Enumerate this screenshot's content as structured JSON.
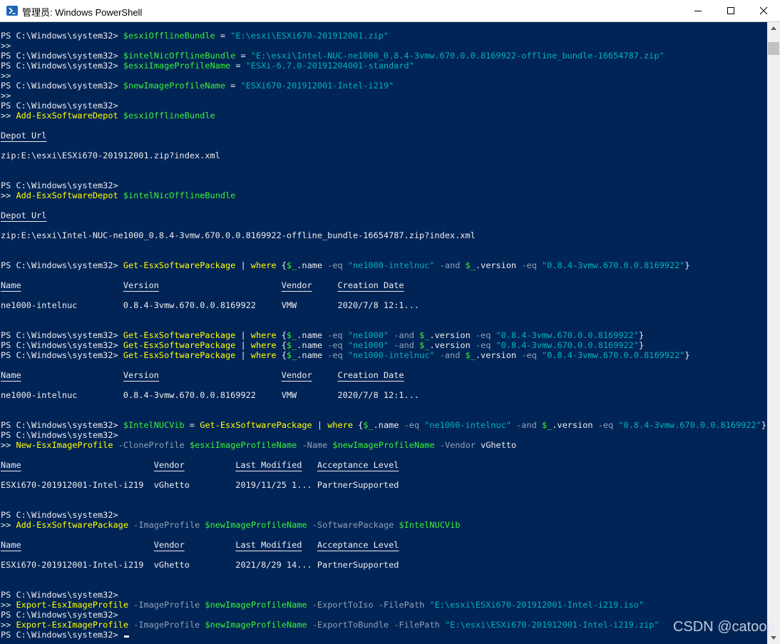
{
  "window": {
    "title": "管理员: Windows PowerShell",
    "icon": "powershell-icon",
    "controls": [
      "minimize-icon",
      "maximize-icon",
      "close-icon"
    ]
  },
  "colors": {
    "background": "#012456",
    "foreground": "#eeedf0",
    "variable": "#3bf13b",
    "command": "#ffff00",
    "string": "#00b5b5",
    "operator": "#8fa0b8"
  },
  "watermark": "CSDN @catoop",
  "console_lines": [
    {
      "segs": [
        {
          "t": "PS C:\\Windows\\system32> "
        },
        {
          "t": "$esxiOfflineBundle",
          "c": "var"
        },
        {
          "t": " = "
        },
        {
          "t": "\"E:\\esxi\\ESXi670-201912001.zip\"",
          "c": "str"
        }
      ]
    },
    {
      "segs": [
        {
          "t": ">>"
        }
      ]
    },
    {
      "segs": [
        {
          "t": "PS C:\\Windows\\system32> "
        },
        {
          "t": "$intelNicOfflineBundle",
          "c": "var"
        },
        {
          "t": " = "
        },
        {
          "t": "\"E:\\esxi\\Intel-NUC-ne1000_0.8.4-3vmw.670.0.0.8169922-offline_bundle-16654787.zip\"",
          "c": "str"
        }
      ]
    },
    {
      "segs": [
        {
          "t": "PS C:\\Windows\\system32> "
        },
        {
          "t": "$esxiImageProfileName",
          "c": "var"
        },
        {
          "t": " = "
        },
        {
          "t": "\"ESXi-6.7.0-20191204001-standard\"",
          "c": "str"
        }
      ]
    },
    {
      "segs": [
        {
          "t": ">>"
        }
      ]
    },
    {
      "segs": [
        {
          "t": "PS C:\\Windows\\system32> "
        },
        {
          "t": "$newImageProfileName",
          "c": "var"
        },
        {
          "t": " = "
        },
        {
          "t": "\"ESXi670-201912001-Intel-i219\"",
          "c": "str"
        }
      ]
    },
    {
      "segs": [
        {
          "t": ">>"
        }
      ]
    },
    {
      "segs": [
        {
          "t": "PS C:\\Windows\\system32>"
        }
      ]
    },
    {
      "segs": [
        {
          "t": ">> "
        },
        {
          "t": "Add-EsxSoftwareDepot",
          "c": "cmd"
        },
        {
          "t": " "
        },
        {
          "t": "$esxiOfflineBundle",
          "c": "var"
        }
      ]
    },
    {
      "segs": []
    },
    {
      "segs": [
        {
          "t": "Depot Url",
          "c": "hdr"
        }
      ]
    },
    {
      "segs": []
    },
    {
      "segs": [
        {
          "t": "zip:E:\\esxi\\ESXi670-201912001.zip?index.xml"
        }
      ]
    },
    {
      "segs": []
    },
    {
      "segs": []
    },
    {
      "segs": [
        {
          "t": "PS C:\\Windows\\system32>"
        }
      ]
    },
    {
      "segs": [
        {
          "t": ">> "
        },
        {
          "t": "Add-EsxSoftwareDepot",
          "c": "cmd"
        },
        {
          "t": " "
        },
        {
          "t": "$intelNicOfflineBundle",
          "c": "var"
        }
      ]
    },
    {
      "segs": []
    },
    {
      "segs": [
        {
          "t": "Depot Url",
          "c": "hdr"
        }
      ]
    },
    {
      "segs": []
    },
    {
      "segs": [
        {
          "t": "zip:E:\\esxi\\Intel-NUC-ne1000_0.8.4-3vmw.670.0.0.8169922-offline_bundle-16654787.zip?index.xml"
        }
      ]
    },
    {
      "segs": []
    },
    {
      "segs": []
    },
    {
      "segs": [
        {
          "t": "PS C:\\Windows\\system32> "
        },
        {
          "t": "Get-EsxSoftwarePackage",
          "c": "cmd"
        },
        {
          "t": " | "
        },
        {
          "t": "where",
          "c": "cmd"
        },
        {
          "t": " {"
        },
        {
          "t": "$_",
          "c": "var"
        },
        {
          "t": ".name "
        },
        {
          "t": "-eq",
          "c": "op"
        },
        {
          "t": " "
        },
        {
          "t": "\"ne1000-intelnuc\"",
          "c": "str"
        },
        {
          "t": " "
        },
        {
          "t": "-and",
          "c": "op"
        },
        {
          "t": " "
        },
        {
          "t": "$_",
          "c": "var"
        },
        {
          "t": ".version "
        },
        {
          "t": "-eq",
          "c": "op"
        },
        {
          "t": " "
        },
        {
          "t": "\"0.8.4-3vmw.670.0.0.8169922\"",
          "c": "str"
        },
        {
          "t": "}"
        }
      ]
    },
    {
      "segs": []
    },
    {
      "segs": [
        {
          "t": "Name",
          "c": "hdr"
        },
        {
          "t": "                    "
        },
        {
          "t": "Version",
          "c": "hdr"
        },
        {
          "t": "                        "
        },
        {
          "t": "Vendor",
          "c": "hdr"
        },
        {
          "t": "     "
        },
        {
          "t": "Creation Date",
          "c": "hdr"
        }
      ]
    },
    {
      "segs": []
    },
    {
      "segs": [
        {
          "t": "ne1000-intelnuc         0.8.4-3vmw.670.0.0.8169922     VMW        2020/7/8 12:1..."
        }
      ]
    },
    {
      "segs": []
    },
    {
      "segs": []
    },
    {
      "segs": [
        {
          "t": "PS C:\\Windows\\system32> "
        },
        {
          "t": "Get-EsxSoftwarePackage",
          "c": "cmd"
        },
        {
          "t": " | "
        },
        {
          "t": "where",
          "c": "cmd"
        },
        {
          "t": " {"
        },
        {
          "t": "$_",
          "c": "var"
        },
        {
          "t": ".name "
        },
        {
          "t": "-eq",
          "c": "op"
        },
        {
          "t": " "
        },
        {
          "t": "\"ne1000\"",
          "c": "str"
        },
        {
          "t": " "
        },
        {
          "t": "-and",
          "c": "op"
        },
        {
          "t": " "
        },
        {
          "t": "$_",
          "c": "var"
        },
        {
          "t": ".version "
        },
        {
          "t": "-eq",
          "c": "op"
        },
        {
          "t": " "
        },
        {
          "t": "\"0.8.4-3vmw.670.0.0.8169922\"",
          "c": "str"
        },
        {
          "t": "}"
        }
      ]
    },
    {
      "segs": [
        {
          "t": "PS C:\\Windows\\system32> "
        },
        {
          "t": "Get-EsxSoftwarePackage",
          "c": "cmd"
        },
        {
          "t": " | "
        },
        {
          "t": "where",
          "c": "cmd"
        },
        {
          "t": " {"
        },
        {
          "t": "$_",
          "c": "var"
        },
        {
          "t": ".name "
        },
        {
          "t": "-eq",
          "c": "op"
        },
        {
          "t": " "
        },
        {
          "t": "\"ne1000\"",
          "c": "str"
        },
        {
          "t": " "
        },
        {
          "t": "-and",
          "c": "op"
        },
        {
          "t": " "
        },
        {
          "t": "$_",
          "c": "var"
        },
        {
          "t": ".version "
        },
        {
          "t": "-eq",
          "c": "op"
        },
        {
          "t": " "
        },
        {
          "t": "\"0.8.4-3vmw.670.0.0.8169922\"",
          "c": "str"
        },
        {
          "t": "}"
        }
      ]
    },
    {
      "segs": [
        {
          "t": "PS C:\\Windows\\system32> "
        },
        {
          "t": "Get-EsxSoftwarePackage",
          "c": "cmd"
        },
        {
          "t": " | "
        },
        {
          "t": "where",
          "c": "cmd"
        },
        {
          "t": " {"
        },
        {
          "t": "$_",
          "c": "var"
        },
        {
          "t": ".name "
        },
        {
          "t": "-eq",
          "c": "op"
        },
        {
          "t": " "
        },
        {
          "t": "\"ne1000-intelnuc\"",
          "c": "str"
        },
        {
          "t": " "
        },
        {
          "t": "-and",
          "c": "op"
        },
        {
          "t": " "
        },
        {
          "t": "$_",
          "c": "var"
        },
        {
          "t": ".version "
        },
        {
          "t": "-eq",
          "c": "op"
        },
        {
          "t": " "
        },
        {
          "t": "\"0.8.4-3vmw.670.0.0.8169922\"",
          "c": "str"
        },
        {
          "t": "}"
        }
      ]
    },
    {
      "segs": []
    },
    {
      "segs": [
        {
          "t": "Name",
          "c": "hdr"
        },
        {
          "t": "                    "
        },
        {
          "t": "Version",
          "c": "hdr"
        },
        {
          "t": "                        "
        },
        {
          "t": "Vendor",
          "c": "hdr"
        },
        {
          "t": "     "
        },
        {
          "t": "Creation Date",
          "c": "hdr"
        }
      ]
    },
    {
      "segs": []
    },
    {
      "segs": [
        {
          "t": "ne1000-intelnuc         0.8.4-3vmw.670.0.0.8169922     VMW        2020/7/8 12:1..."
        }
      ]
    },
    {
      "segs": []
    },
    {
      "segs": []
    },
    {
      "segs": [
        {
          "t": "PS C:\\Windows\\system32> "
        },
        {
          "t": "$IntelNUCVib",
          "c": "var"
        },
        {
          "t": " = "
        },
        {
          "t": "Get-EsxSoftwarePackage",
          "c": "cmd"
        },
        {
          "t": " | "
        },
        {
          "t": "where",
          "c": "cmd"
        },
        {
          "t": " {"
        },
        {
          "t": "$_",
          "c": "var"
        },
        {
          "t": ".name "
        },
        {
          "t": "-eq",
          "c": "op"
        },
        {
          "t": " "
        },
        {
          "t": "\"ne1000-intelnuc\"",
          "c": "str"
        },
        {
          "t": " "
        },
        {
          "t": "-and",
          "c": "op"
        },
        {
          "t": " "
        },
        {
          "t": "$_",
          "c": "var"
        },
        {
          "t": ".version "
        },
        {
          "t": "-eq",
          "c": "op"
        },
        {
          "t": " "
        },
        {
          "t": "\"0.8.4-3vmw.670.0.0.8169922\"",
          "c": "str"
        },
        {
          "t": "}"
        }
      ]
    },
    {
      "segs": [
        {
          "t": "PS C:\\Windows\\system32>"
        }
      ]
    },
    {
      "segs": [
        {
          "t": ">> "
        },
        {
          "t": "New-EsxImageProfile",
          "c": "cmd"
        },
        {
          "t": " "
        },
        {
          "t": "-CloneProfile",
          "c": "op"
        },
        {
          "t": " "
        },
        {
          "t": "$esxiImageProfileName",
          "c": "var"
        },
        {
          "t": " "
        },
        {
          "t": "-Name",
          "c": "op"
        },
        {
          "t": " "
        },
        {
          "t": "$newImageProfileName",
          "c": "var"
        },
        {
          "t": " "
        },
        {
          "t": "-Vendor",
          "c": "op"
        },
        {
          "t": " vGhetto"
        }
      ]
    },
    {
      "segs": []
    },
    {
      "segs": [
        {
          "t": "Name",
          "c": "hdr"
        },
        {
          "t": "                          "
        },
        {
          "t": "Vendor",
          "c": "hdr"
        },
        {
          "t": "          "
        },
        {
          "t": "Last Modified",
          "c": "hdr"
        },
        {
          "t": "   "
        },
        {
          "t": "Acceptance Level",
          "c": "hdr"
        }
      ]
    },
    {
      "segs": []
    },
    {
      "segs": [
        {
          "t": "ESXi670-201912001-Intel-i219  vGhetto         2019/11/25 1... PartnerSupported"
        }
      ]
    },
    {
      "segs": []
    },
    {
      "segs": []
    },
    {
      "segs": [
        {
          "t": "PS C:\\Windows\\system32>"
        }
      ]
    },
    {
      "segs": [
        {
          "t": ">> "
        },
        {
          "t": "Add-EsxSoftwarePackage",
          "c": "cmd"
        },
        {
          "t": " "
        },
        {
          "t": "-ImageProfile",
          "c": "op"
        },
        {
          "t": " "
        },
        {
          "t": "$newImageProfileName",
          "c": "var"
        },
        {
          "t": " "
        },
        {
          "t": "-SoftwarePackage",
          "c": "op"
        },
        {
          "t": " "
        },
        {
          "t": "$IntelNUCVib",
          "c": "var"
        }
      ]
    },
    {
      "segs": []
    },
    {
      "segs": [
        {
          "t": "Name",
          "c": "hdr"
        },
        {
          "t": "                          "
        },
        {
          "t": "Vendor",
          "c": "hdr"
        },
        {
          "t": "          "
        },
        {
          "t": "Last Modified",
          "c": "hdr"
        },
        {
          "t": "   "
        },
        {
          "t": "Acceptance Level",
          "c": "hdr"
        }
      ]
    },
    {
      "segs": []
    },
    {
      "segs": [
        {
          "t": "ESXi670-201912001-Intel-i219  vGhetto         2021/8/29 14... PartnerSupported"
        }
      ]
    },
    {
      "segs": []
    },
    {
      "segs": []
    },
    {
      "segs": [
        {
          "t": "PS C:\\Windows\\system32>"
        }
      ]
    },
    {
      "segs": [
        {
          "t": ">> "
        },
        {
          "t": "Export-EsxImageProfile",
          "c": "cmd"
        },
        {
          "t": " "
        },
        {
          "t": "-ImageProfile",
          "c": "op"
        },
        {
          "t": " "
        },
        {
          "t": "$newImageProfileName",
          "c": "var"
        },
        {
          "t": " "
        },
        {
          "t": "-ExportToIso",
          "c": "op"
        },
        {
          "t": " "
        },
        {
          "t": "-FilePath",
          "c": "op"
        },
        {
          "t": " "
        },
        {
          "t": "\"E:\\esxi\\ESXi670-201912001-Intel-i219.iso\"",
          "c": "str"
        }
      ]
    },
    {
      "segs": [
        {
          "t": "PS C:\\Windows\\system32>"
        }
      ]
    },
    {
      "segs": [
        {
          "t": ">> "
        },
        {
          "t": "Export-EsxImageProfile",
          "c": "cmd"
        },
        {
          "t": " "
        },
        {
          "t": "-ImageProfile",
          "c": "op"
        },
        {
          "t": " "
        },
        {
          "t": "$newImageProfileName",
          "c": "var"
        },
        {
          "t": " "
        },
        {
          "t": "-ExportToBundle",
          "c": "op"
        },
        {
          "t": " "
        },
        {
          "t": "-FilePath",
          "c": "op"
        },
        {
          "t": " "
        },
        {
          "t": "\"E:\\esxi\\ESXi670-201912001-Intel-i219.zip\"",
          "c": "str"
        }
      ]
    },
    {
      "segs": [
        {
          "t": "PS C:\\Windows\\system32> "
        }
      ],
      "cursor": true
    }
  ]
}
